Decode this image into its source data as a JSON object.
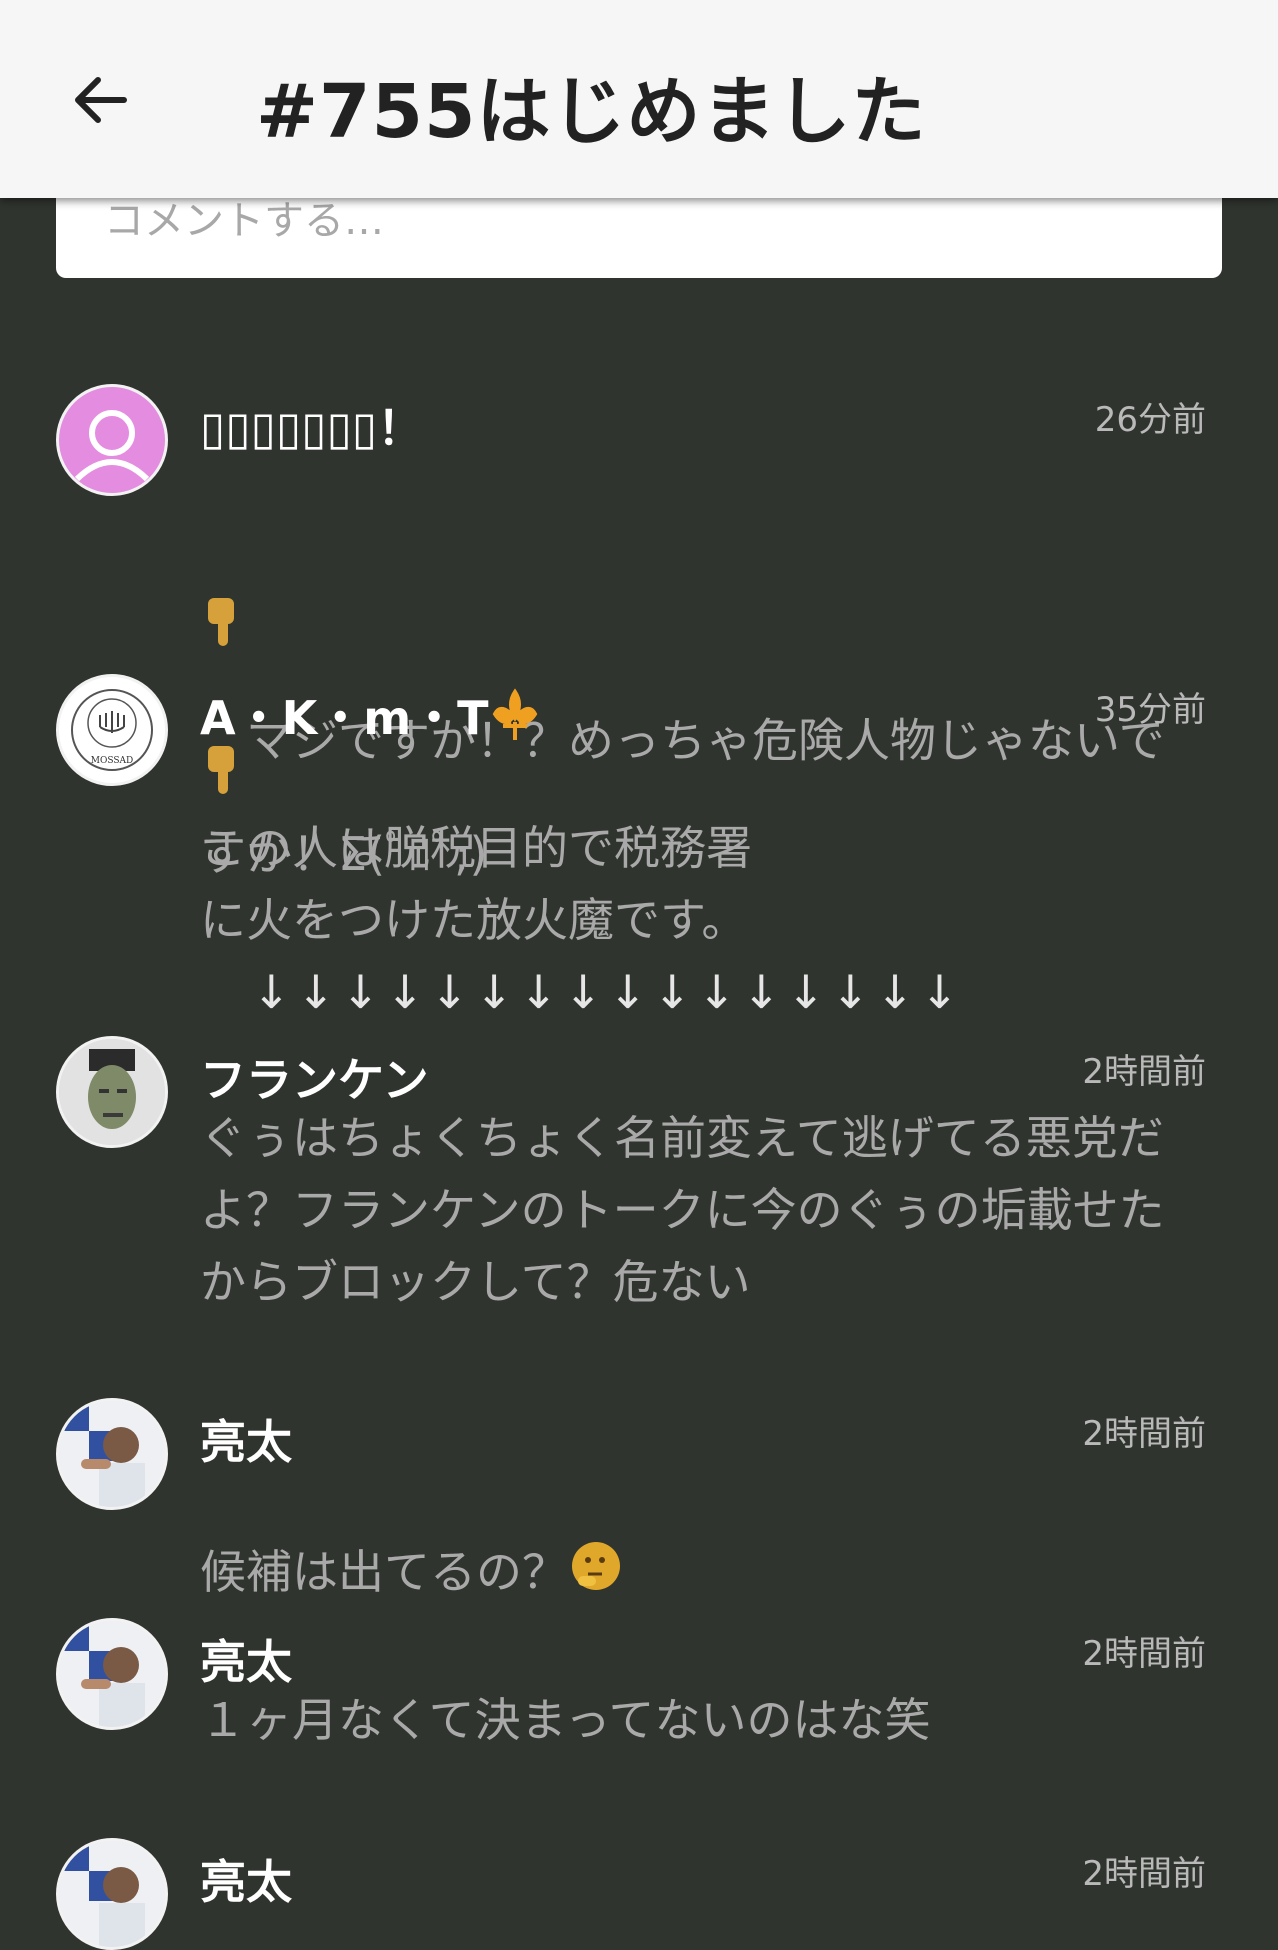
{
  "header": {
    "title": "#755はじめました",
    "back_icon": "arrow-left-icon"
  },
  "comment_input": {
    "placeholder": "コメントする…"
  },
  "colors": {
    "background": "#30342f",
    "appbar": "#f6f6f6",
    "name_text": "#ffffff",
    "body_text": "#a9a9a9",
    "time_text": "#b9b9b9"
  },
  "comments": [
    {
      "name": "▯▯▯▯▯▯▯！",
      "time": "26分前",
      "avatar_icon": "default-user-avatar-icon",
      "emojis": "pointing-down-hand-icon pointing-down-hand-icon",
      "text": "マジですか！？めっちゃ危険人物じゃないですか！Σ(ﾟﾛﾟ;)"
    },
    {
      "name": "A・K・m・T",
      "time": "35分前",
      "avatar_icon": "mossad-seal-avatar-icon",
      "avatar_label": "MOSSAD",
      "name_icon": "fleur-de-lis-icon",
      "text": "この人は脱税目的で税務署\nに火をつけた放火魔です。",
      "arrows": "　↓↓↓↓↓↓↓↓↓↓↓↓↓↓↓↓"
    },
    {
      "name": "フランケン",
      "time": "2時間前",
      "avatar_icon": "frankenstein-avatar-icon",
      "text": "ぐぅはちょくちょく名前変えて逃げてる悪党だよ？フランケンのトークに今のぐぅの垢載せたからブロックして？危ない"
    },
    {
      "name": "亮太",
      "time": "2時間前",
      "avatar_icon": "photo-user-avatar-icon",
      "text": "候補は出てるの？",
      "emoji": "thinking-face-icon"
    },
    {
      "name": "亮太",
      "time": "2時間前",
      "avatar_icon": "photo-user-avatar-icon",
      "text": "１ヶ月なくて決まってないのはな笑"
    },
    {
      "name": "亮太",
      "time": "2時間前",
      "avatar_icon": "photo-user-avatar-icon",
      "text": ""
    }
  ]
}
